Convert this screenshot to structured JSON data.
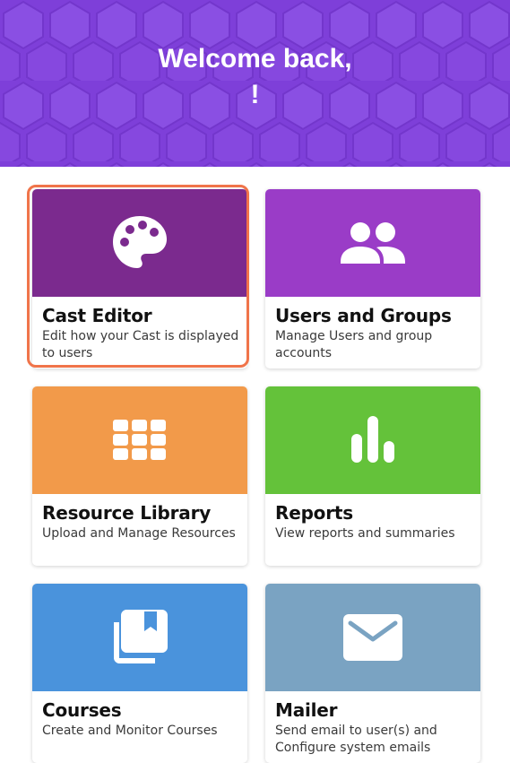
{
  "header": {
    "welcome": "Welcome back,",
    "name_line": "!"
  },
  "cards": [
    {
      "title": "Cast Editor",
      "description": "Edit how your Cast is displayed to users",
      "color": "#7b2a8e",
      "icon": "palette-icon"
    },
    {
      "title": "Users and Groups",
      "description": "Manage Users and group accounts",
      "color": "#9a3cc7",
      "icon": "users-icon"
    },
    {
      "title": "Resource Library",
      "description": "Upload and Manage Resources",
      "color": "#f29a4a",
      "icon": "grid-icon"
    },
    {
      "title": "Reports",
      "description": "View reports and summaries",
      "color": "#64c23a",
      "icon": "bar-chart-icon"
    },
    {
      "title": "Courses",
      "description": "Create and Monitor Courses",
      "color": "#4a93dc",
      "icon": "library-book-icon"
    },
    {
      "title": "Mailer",
      "description": "Send email to user(s) and Configure system emails",
      "color": "#7aa3c2",
      "icon": "mail-icon"
    }
  ],
  "colors": {
    "hero_background": "#7e3fd9",
    "selection_outline": "#f0744a"
  }
}
